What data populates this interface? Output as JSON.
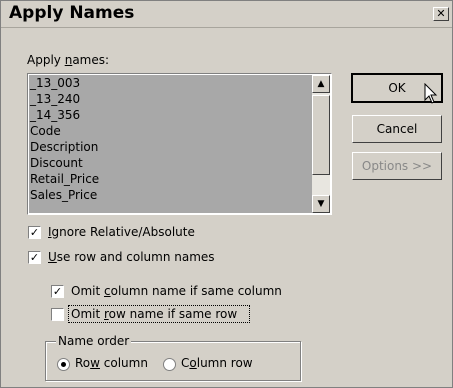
{
  "window": {
    "title": "Apply Names",
    "close_glyph": "✕"
  },
  "list": {
    "label_pre": "Apply ",
    "label_underline": "n",
    "label_post": "ames:",
    "items": [
      "_13_003",
      "_13_240",
      "_14_356",
      "Code",
      "Description",
      "Discount",
      "Retail_Price",
      "Sales_Price"
    ]
  },
  "buttons": {
    "ok": "OK",
    "cancel": "Cancel",
    "options": "Options >>"
  },
  "options": {
    "ignore_relative_u": "I",
    "ignore_relative_rest": "gnore Relative/Absolute",
    "ignore_relative_checked": true,
    "use_row_col_u": "U",
    "use_row_col_rest": "se row and column names",
    "use_row_col_checked": true,
    "omit_col_pre": "Omit ",
    "omit_col_u": "c",
    "omit_col_post": "olumn name if same column",
    "omit_col_checked": true,
    "omit_row_pre": "Omit ",
    "omit_row_u": "r",
    "omit_row_post": "ow name if same row",
    "omit_row_checked": false
  },
  "name_order": {
    "title": "Name order",
    "row_column_pre": "Ro",
    "row_column_u": "w",
    "row_column_post": " column",
    "column_row_pre": "C",
    "column_row_u": "o",
    "column_row_post": "lumn row",
    "selected": "row_column"
  }
}
